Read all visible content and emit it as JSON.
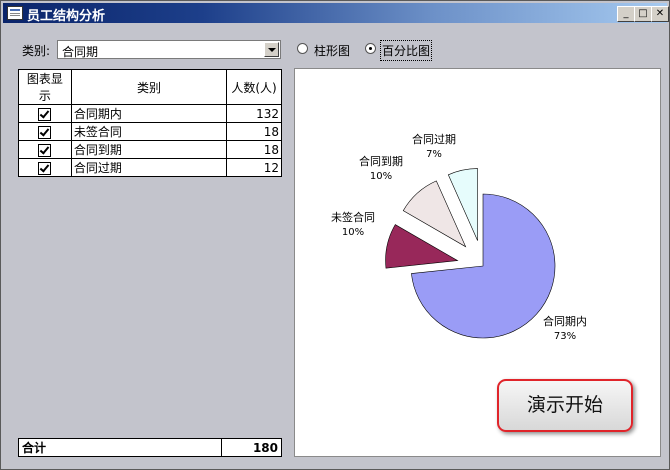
{
  "window": {
    "title": "员工结构分析"
  },
  "category": {
    "label": "类别:",
    "value": "合同期"
  },
  "chart_type": {
    "bar_label": "柱形图",
    "percent_label": "百分比图",
    "selected": "percent"
  },
  "table": {
    "headers": [
      "图表显示",
      "类别",
      "人数(人)"
    ],
    "rows": [
      {
        "show": true,
        "name": "合同期内",
        "count": 132
      },
      {
        "show": true,
        "name": "未签合同",
        "count": 18
      },
      {
        "show": true,
        "name": "合同到期",
        "count": 18
      },
      {
        "show": true,
        "name": "合同过期",
        "count": 12
      }
    ],
    "total_label": "合计",
    "total_value": 180
  },
  "demo_button": {
    "label": "演示开始"
  },
  "chart_data": {
    "type": "pie",
    "exploded": true,
    "slices": [
      {
        "label": "合同期内",
        "pct_label": "73%",
        "value": 132,
        "color": "#9a9cf6"
      },
      {
        "label": "未签合同",
        "pct_label": "10%",
        "value": 18,
        "color": "#98285a"
      },
      {
        "label": "合同到期",
        "pct_label": "10%",
        "value": 18,
        "color": "#efe6e6"
      },
      {
        "label": "合同过期",
        "pct_label": "7%",
        "value": 12,
        "color": "#e6fcfc"
      }
    ]
  }
}
